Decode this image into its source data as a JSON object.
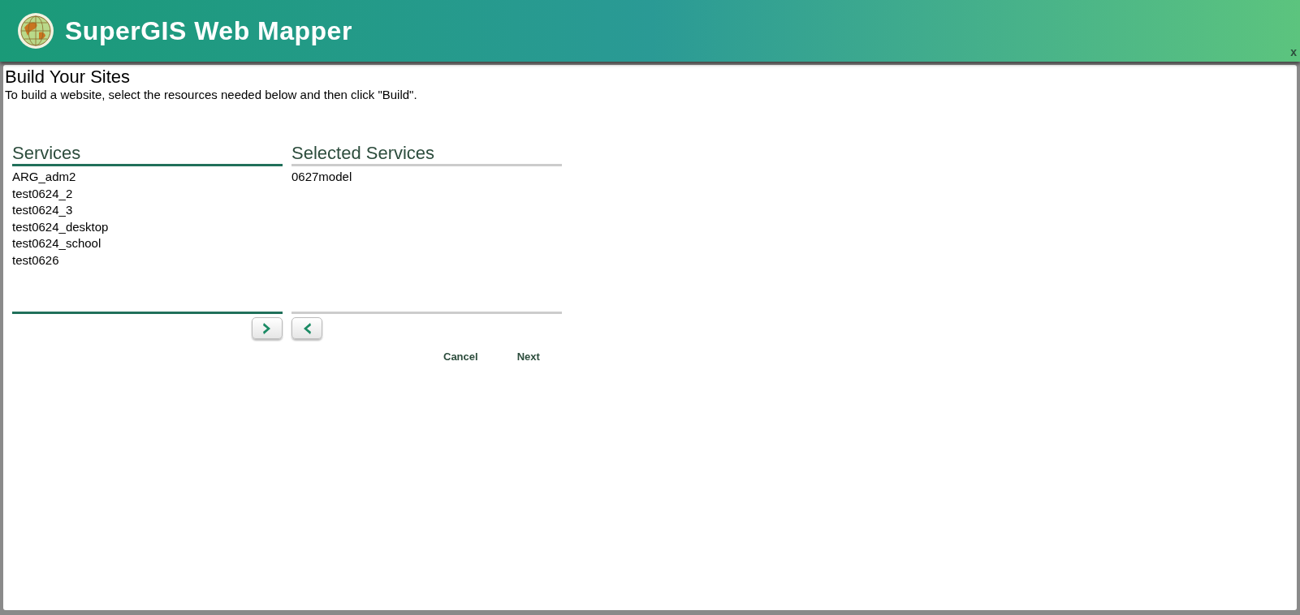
{
  "header": {
    "title": "SuperGIS Web Mapper",
    "close": "x"
  },
  "page": {
    "title": "Build Your Sites",
    "instructions": "To build a website, select the resources needed below and then click \"Build\"."
  },
  "services": {
    "heading": "Services",
    "items": [
      "ARG_adm2",
      "test0624_2",
      "test0624_3",
      "test0624_desktop",
      "test0624_school",
      "test0626"
    ]
  },
  "selected_services": {
    "heading": "Selected Services",
    "items": [
      "0627model"
    ]
  },
  "buttons": [
    "Cancel",
    "Next"
  ]
}
